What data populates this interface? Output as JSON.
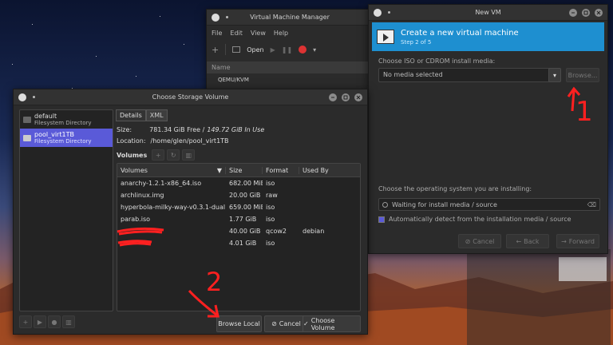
{
  "vmm": {
    "title": "Virtual Machine Manager",
    "menu": [
      "File",
      "Edit",
      "View",
      "Help"
    ],
    "open_label": "Open",
    "column_name": "Name",
    "row": "QEMU/KVM"
  },
  "newvm": {
    "title": "New VM",
    "header_title": "Create a new virtual machine",
    "header_step": "Step 2 of 5",
    "media_label": "Choose ISO or CDROM install media:",
    "media_value": "No media selected",
    "browse_label": "Browse...",
    "os_label": "Choose the operating system you are installing:",
    "os_placeholder": "Waiting for install media / source",
    "auto_detect_label": "Automatically detect from the installation media / source",
    "cancel_label": "Cancel",
    "back_label": "Back",
    "forward_label": "Forward"
  },
  "storage": {
    "title": "Choose Storage Volume",
    "pools": [
      {
        "name": "default",
        "type": "Filesystem Directory"
      },
      {
        "name": "pool_virt1TB",
        "type": "Filesystem Directory"
      }
    ],
    "tabs": [
      "Details",
      "XML"
    ],
    "size_label": "Size:",
    "size_free": "781.34 GiB Free /",
    "size_inuse": "149.72 GiB In Use",
    "location_label": "Location:",
    "location_value": "/home/glen/pool_virt1TB",
    "volumes_label": "Volumes",
    "columns": [
      "Volumes",
      "Size",
      "Format",
      "Used By"
    ],
    "rows": [
      {
        "name": "anarchy-1.2.1-x86_64.iso",
        "size": "682.00 MiB",
        "format": "iso",
        "used": ""
      },
      {
        "name": "archlinux.img",
        "size": "20.00 GiB",
        "format": "raw",
        "used": ""
      },
      {
        "name": "hyperbola-milky-way-v0.3.1-dual.iso",
        "size": "659.00 MiB",
        "format": "iso",
        "used": ""
      },
      {
        "name": "parab.iso",
        "size": "1.77 GiB",
        "format": "iso",
        "used": ""
      },
      {
        "name": "",
        "size": "40.00 GiB",
        "format": "qcow2",
        "used": "debian"
      },
      {
        "name": "",
        "size": "4.01 GiB",
        "format": "iso",
        "used": ""
      }
    ],
    "browse_local_label": "Browse Local",
    "cancel_label": "Cancel",
    "choose_label": "Choose Volume"
  },
  "annotations": {
    "one": "1",
    "two": "2"
  },
  "colors": {
    "accent": "#1e8fd0",
    "selection": "#5a5ad8",
    "annotation": "#ff2020"
  }
}
